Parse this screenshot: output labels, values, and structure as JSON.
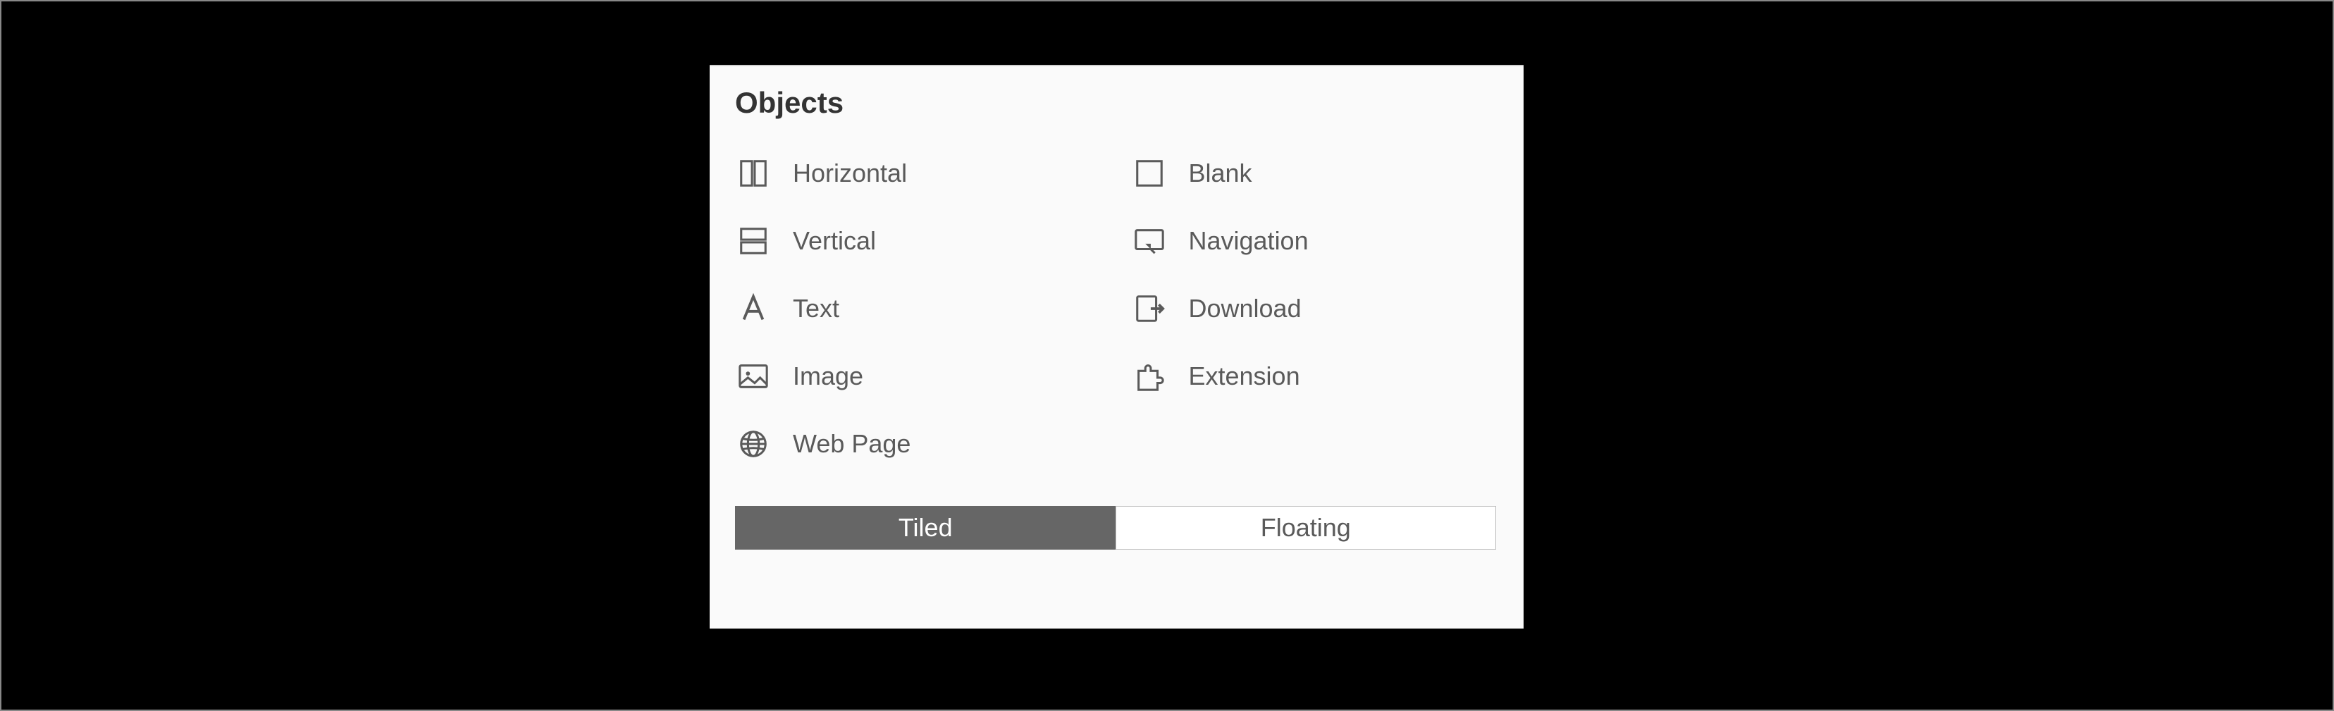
{
  "panel": {
    "title": "Objects",
    "objects": {
      "horizontal": "Horizontal",
      "vertical": "Vertical",
      "text": "Text",
      "image": "Image",
      "webpage": "Web Page",
      "blank": "Blank",
      "navigation": "Navigation",
      "download": "Download",
      "extension": "Extension"
    },
    "toggle": {
      "tiled": "Tiled",
      "floating": "Floating",
      "active": "tiled"
    }
  }
}
